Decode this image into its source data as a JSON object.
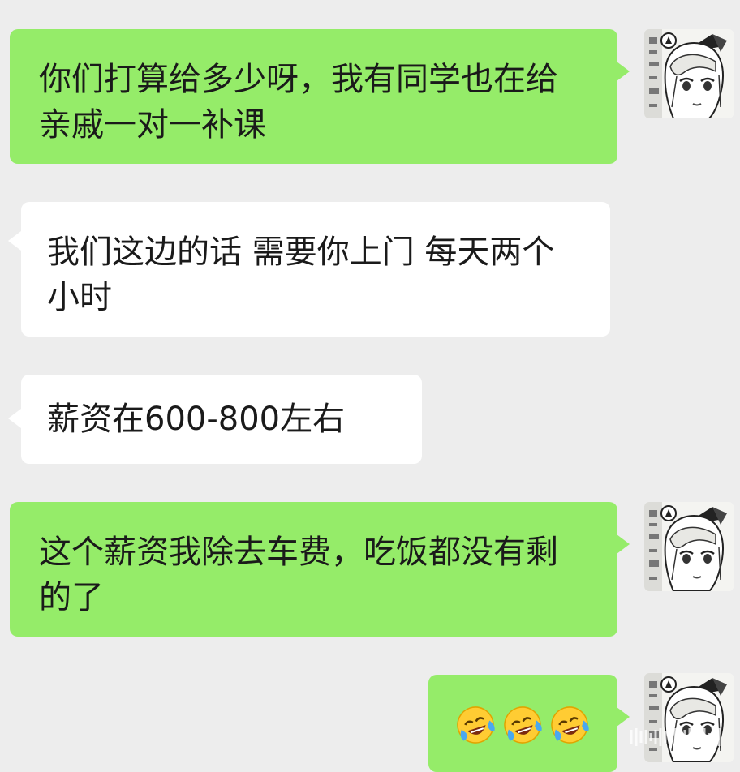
{
  "messages": [
    {
      "direction": "outgoing",
      "text": "你们打算给多少呀，我有同学也在给亲戚一对一补课"
    },
    {
      "direction": "incoming",
      "text": "我们这边的话 需要你上门 每天两个小时"
    },
    {
      "direction": "incoming",
      "text": "薪资在600-800左右"
    },
    {
      "direction": "outgoing",
      "text": "这个薪资我除去车费，吃饭都没有剩的了"
    },
    {
      "direction": "outgoing",
      "emojis": [
        "laugh-cry-emoji",
        "laugh-cry-emoji",
        "laugh-cry-emoji"
      ]
    }
  ],
  "avatar": {
    "icon": "anime-avatar-icon"
  },
  "colors": {
    "background": "#ededed",
    "outgoing_bubble": "#95ec69",
    "incoming_bubble": "#ffffff",
    "text": "#1a1a1a"
  }
}
